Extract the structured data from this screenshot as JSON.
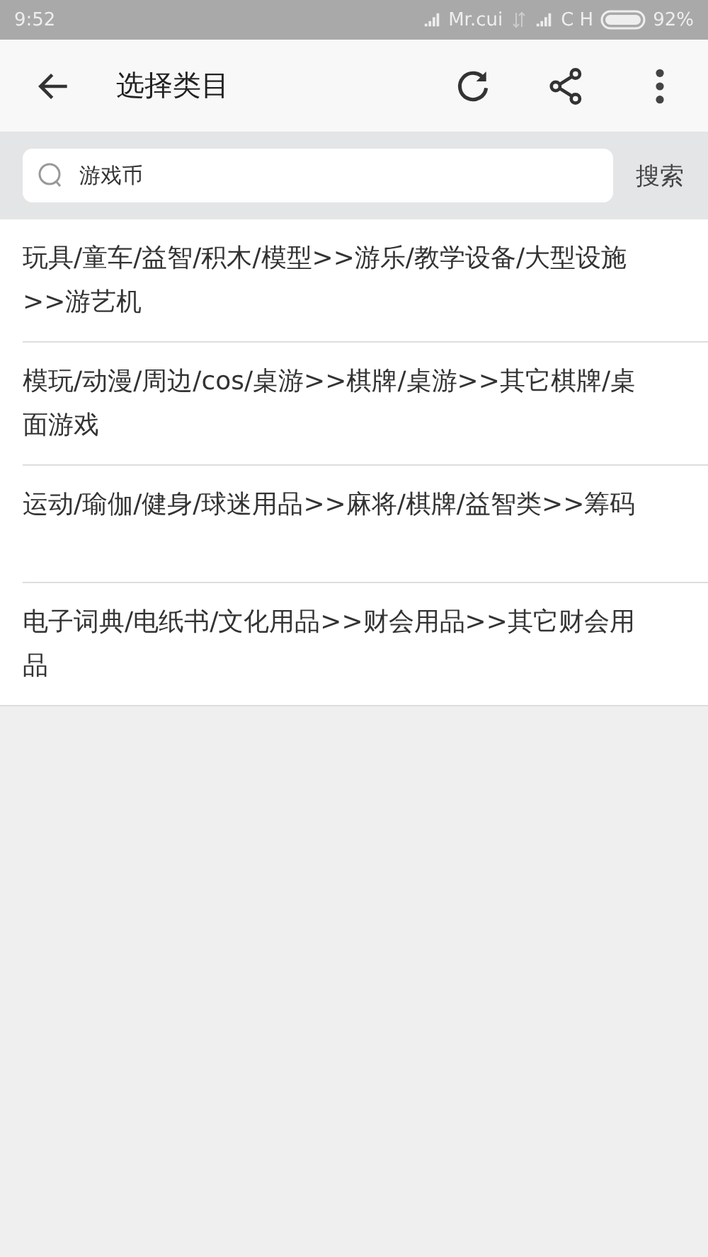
{
  "status_bar": {
    "time": "9:52",
    "carrier": "Mr.cui",
    "network": "C H",
    "battery": "92%"
  },
  "toolbar": {
    "title": "选择类目"
  },
  "search": {
    "value": "游戏币",
    "button": "搜索"
  },
  "categories": [
    {
      "label": "玩具/童车/益智/积木/模型>>游乐/教学设备/大型设施>>游艺机"
    },
    {
      "label": "模玩/动漫/周边/cos/桌游>>棋牌/桌游>>其它棋牌/桌面游戏"
    },
    {
      "label": "运动/瑜伽/健身/球迷用品>>麻将/棋牌/益智类>>筹码"
    },
    {
      "label": "电子词典/电纸书/文化用品>>财会用品>>其它财会用品"
    }
  ]
}
